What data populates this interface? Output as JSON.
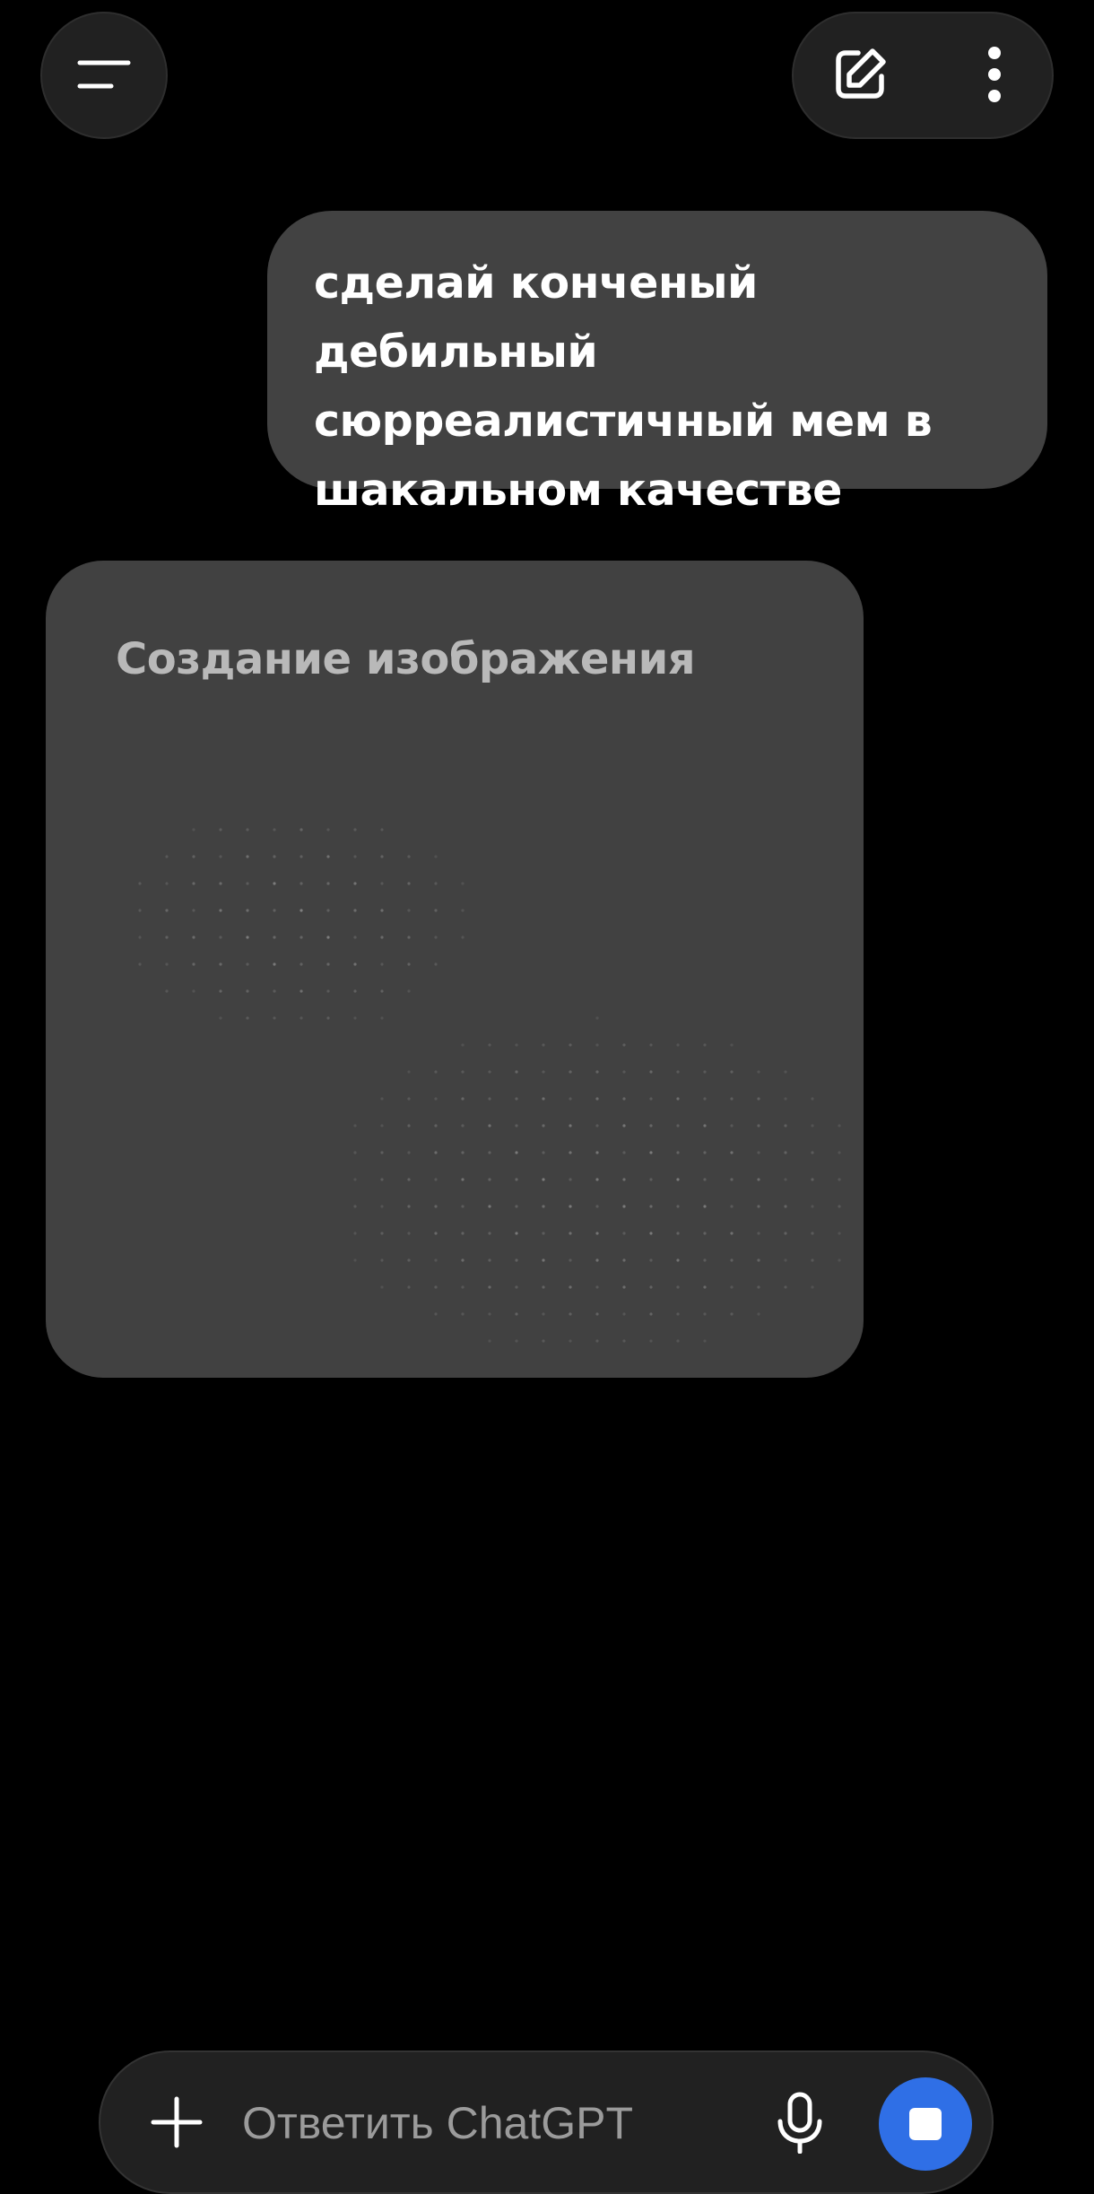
{
  "header": {
    "menu_icon": "menu-lines-icon",
    "new_chat_icon": "compose-edit-icon",
    "more_icon": "vertical-dots-icon"
  },
  "conversation": {
    "user_message": "сделай конченый дебильный\nсюрреалистичный мем в\nшакальном качестве",
    "assistant_card": {
      "title": "Создание изображения",
      "state": "generating"
    }
  },
  "composer": {
    "add_icon": "plus-icon",
    "placeholder": "Ответить ChatGPT",
    "mic_icon": "microphone-icon",
    "stop_icon": "stop-icon"
  },
  "colors": {
    "background": "#000000",
    "bubble": "#424242",
    "card": "#414141",
    "control_bg": "#212121",
    "accent": "#2f6fe6",
    "muted_text": "#9b9b9b"
  }
}
